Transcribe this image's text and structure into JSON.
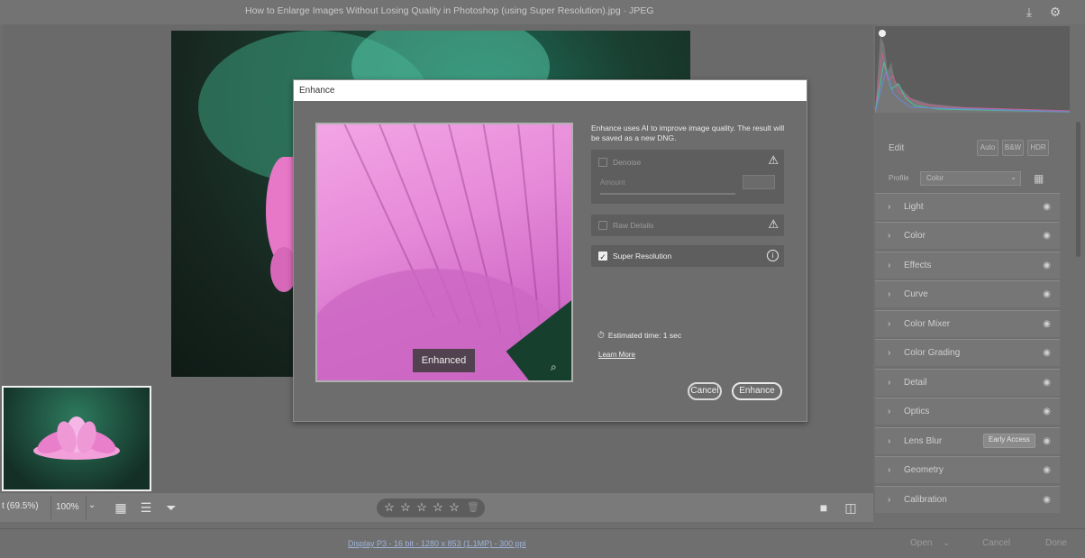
{
  "titlebar": {
    "title": "How to Enlarge Images Without Losing Quality in Photoshop (using Super Resolution).jpg  ·  JPEG",
    "export_icon": "export-icon",
    "settings_icon": "gear-icon"
  },
  "bottombar": {
    "zoom_fit": "t (69.5%)",
    "zoom_pct": "100%",
    "zoom_dropdown": "⌄",
    "stars": [
      "☆",
      "☆",
      "☆",
      "☆",
      "☆"
    ]
  },
  "statusbar": {
    "info": "Display P3 - 16 bit - 1280 x 853 (1.1MP) - 300 ppi",
    "open": "Open",
    "cancel": "Cancel",
    "done": "Done"
  },
  "rightpanel": {
    "edit_label": "Edit",
    "auto": "Auto",
    "bw": "B&W",
    "hdr": "HDR",
    "profile_label": "Profile",
    "profile_value": "Color",
    "sections": [
      {
        "label": "Light"
      },
      {
        "label": "Color"
      },
      {
        "label": "Effects"
      },
      {
        "label": "Curve"
      },
      {
        "label": "Color Mixer"
      },
      {
        "label": "Color Grading"
      },
      {
        "label": "Detail"
      },
      {
        "label": "Optics"
      },
      {
        "label": "Lens Blur",
        "badge": "Early Access"
      },
      {
        "label": "Geometry"
      },
      {
        "label": "Calibration"
      }
    ]
  },
  "dialog": {
    "title": "Enhance",
    "preview_tag": "Enhanced",
    "description": "Enhance uses AI to improve image quality. The result will be saved as a new DNG.",
    "denoise": {
      "label": "Denoise",
      "checked": false,
      "amount_label": "Amount"
    },
    "raw_details": {
      "label": "Raw Details",
      "checked": false
    },
    "super_resolution": {
      "label": "Super Resolution",
      "checked": true
    },
    "estimated": "Estimated time: 1 sec",
    "learn_more": "Learn More",
    "cancel": "Cancel",
    "enhance": "Enhance"
  },
  "colors": {
    "background": "#6e6e6e",
    "dialog_title_bg": "#ffffff",
    "preview_pink": "#e68ad8"
  }
}
